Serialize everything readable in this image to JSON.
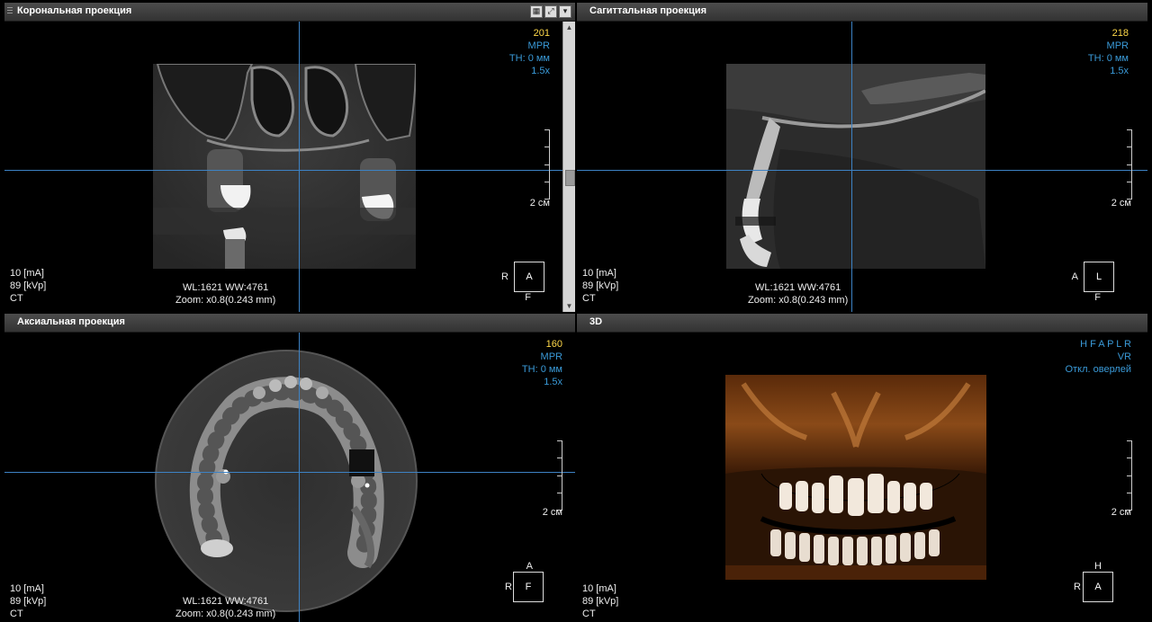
{
  "coronal": {
    "title": "Корональная проекция",
    "slice": "201",
    "mode": "MPR",
    "thickness": "TH: 0 мм",
    "zoom_factor": "1.5x",
    "ma": "10 [mA]",
    "kvp": "89 [kVp]",
    "modality": "CT",
    "wlww": "WL:1621 WW:4761",
    "zoom": "Zoom: x0.8(0.243 mm)",
    "scale": "2 см",
    "orient_left": "R",
    "orient_box": "A",
    "orient_bottom": "F",
    "toolbar_icons": [
      "layout-icon",
      "maximize-icon",
      "menu-down-icon"
    ]
  },
  "sagittal": {
    "title": "Сагиттальная проекция",
    "slice": "218",
    "mode": "MPR",
    "thickness": "TH: 0 мм",
    "zoom_factor": "1.5x",
    "ma": "10 [mA]",
    "kvp": "89 [kVp]",
    "modality": "CT",
    "wlww": "WL:1621 WW:4761",
    "zoom": "Zoom: x0.8(0.243 mm)",
    "scale": "2 см",
    "orient_left": "A",
    "orient_box": "L",
    "orient_bottom": "F"
  },
  "axial": {
    "title": "Аксиальная проекция",
    "slice": "160",
    "mode": "MPR",
    "thickness": "TH: 0 мм",
    "zoom_factor": "1.5x",
    "ma": "10 [mA]",
    "kvp": "89 [kVp]",
    "modality": "CT",
    "wlww": "WL:1621 WW:4761",
    "zoom": "Zoom: x0.8(0.243 mm)",
    "scale": "2 см",
    "orient_top": "A",
    "orient_left": "R",
    "orient_box": "F"
  },
  "volume3d": {
    "title": "3D",
    "orient_letters": "H F A P L R",
    "mode": "VR",
    "clip": "Откл. оверлей",
    "ma": "10 [mA]",
    "kvp": "89 [kVp]",
    "modality": "CT",
    "scale": "2 см",
    "orient_top": "H",
    "orient_left": "R",
    "orient_box": "A"
  },
  "colors": {
    "crosshair": "#3d82c4",
    "slice_number": "#ffd94a",
    "overlay_blue": "#3a9ad8",
    "titlebar": "#3f3f3f"
  }
}
